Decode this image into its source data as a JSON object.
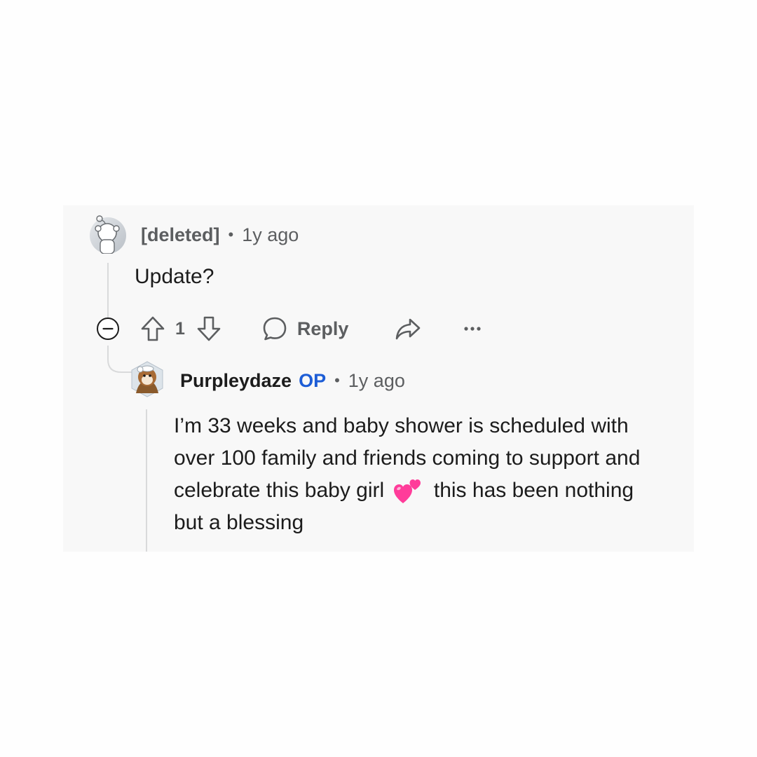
{
  "comment_1": {
    "author": "[deleted]",
    "separator": "•",
    "time": "1y ago",
    "body": "Update?",
    "avatar_icon": "snoo-avatar-icon"
  },
  "actions": {
    "collapse_icon": "collapse-minus-icon",
    "upvote_icon": "upvote-arrow-icon",
    "vote_count": "1",
    "downvote_icon": "downvote-arrow-icon",
    "reply_icon": "speech-bubble-icon",
    "reply_label": "Reply",
    "share_icon": "share-arrow-icon",
    "more_icon": "more-dots-icon"
  },
  "comment_2": {
    "author": "Purpleydaze",
    "badge": "OP",
    "separator": "•",
    "time": "1y ago",
    "body_part1": "I’m 33 weeks and baby shower is scheduled with over 100 family and friends coming to support and celebrate this baby girl",
    "emoji": "two-hearts-emoji",
    "body_part2": "this has been nothing but a blessing",
    "avatar_icon": "bear-avatar-icon"
  },
  "colors": {
    "card_bg": "#f8f8f8",
    "meta_text": "#5c5e60",
    "body_text": "#1c1c1c",
    "op_badge": "#1d5dd6",
    "thread_line": "#d9dadb",
    "heart": "#ff3c9a"
  }
}
